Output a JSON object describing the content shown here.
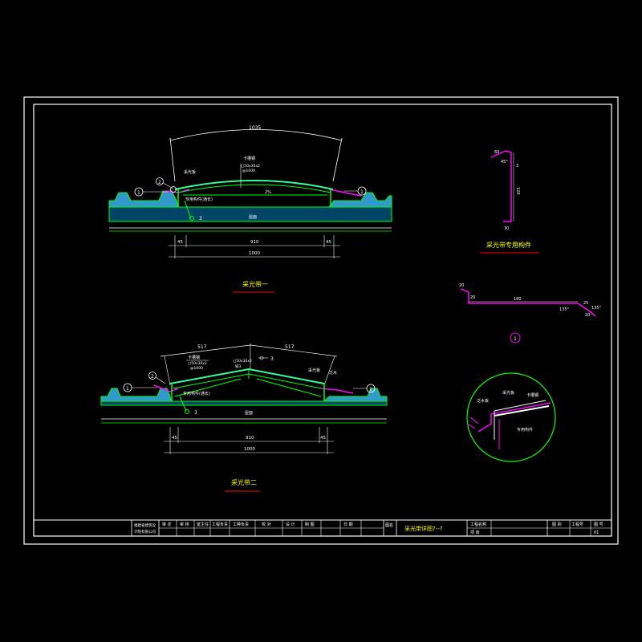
{
  "colors": {
    "background": "#000000",
    "frame": "#ffffff",
    "structure": "#00ff00",
    "purlin": "#33ff99",
    "flashing": "#ff00ff",
    "dimension": "#ffffff",
    "text": "#ffffff",
    "title_text": "#ffff00",
    "red_underline": "#ff0000",
    "detail_circle": "#ff00ff",
    "concrete_fill": "#3399cc"
  },
  "section1": {
    "title": "采光带一",
    "dim_arc": "1035",
    "dim_45_left": "45",
    "dim_910": "910",
    "dim_45_right": "45",
    "dim_total": "1000",
    "label_purlin": "卡槽钢",
    "label_purlin_spec1": "□50x30x2",
    "label_purlin_spec2": "@1000",
    "label_panel": "采光板",
    "label_slope": "2%",
    "label_bracket": "专用构件(通长)",
    "label_base": "屋面",
    "bubble_1": "1",
    "bubble_2": "2",
    "bubble_3": "3",
    "marker_3": "3"
  },
  "section2": {
    "title": "采光带二",
    "dim_517_left": "517",
    "dim_517_right": "517",
    "dim_45_left": "45",
    "dim_910": "910",
    "dim_45_right": "45",
    "dim_total": "1000",
    "label_purlin": "卡槽钢",
    "label_purlin_spec1": "□50x30x2",
    "label_purlin_spec2": "@1000",
    "label_slope": "坡3",
    "label_panel_right": "采光板",
    "label_flashing_right": "泛水",
    "label_bracket": "专用构件(通长)",
    "label_base": "屋面",
    "slope_marker": "3",
    "bubble_1": "1",
    "bubble_2": "2",
    "marker_3": "3"
  },
  "detail_bracket": {
    "title": "采光带专用构件",
    "dim_top": "60",
    "dim_angle": "45°",
    "dim_3": "3",
    "dim_height": "120",
    "dim_bottom": "30"
  },
  "detail_profile": {
    "dim_20_top": "20",
    "dim_20_left": "20",
    "dim_160": "160",
    "dim_25": "25",
    "dim_135_left": "135°",
    "dim_135_right": "135°",
    "dim_20_right": "20"
  },
  "detail_circle": {
    "bubble": "1",
    "label_panel": "采光板",
    "label_purlin": "卡槽钢",
    "label_flashing": "泛水板",
    "label_bracket": "专用构件"
  },
  "title_block": {
    "company_line1": "福建省建筑设",
    "company_line2": "计院有限公司",
    "headers": [
      "审 定",
      "审 核",
      "室主任",
      "工程负责",
      "工种负责",
      "校 对",
      "设 计",
      "制 图",
      "日 期"
    ],
    "drawing_label": "图名",
    "drawing_name": "采光带详图?--?",
    "project_label": "工程名称",
    "item_label": "项 目",
    "right_headers": [
      "图 别",
      "工程号",
      "图 号"
    ],
    "sheet_no": "01"
  }
}
